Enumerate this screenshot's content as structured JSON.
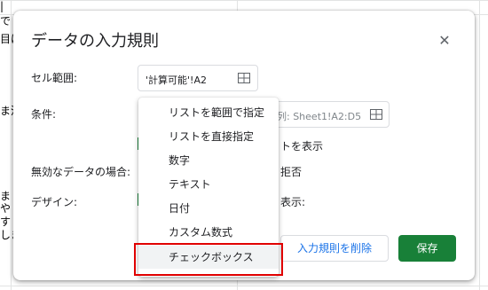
{
  "background": {
    "fragments": [
      "|",
      "で",
      "目は",
      "ま活",
      "ま",
      "や",
      "す",
      "しま"
    ]
  },
  "dialog": {
    "title": "データの入力規則",
    "close_icon": "close-icon",
    "labels": {
      "range": "セル範囲:",
      "criteria": "条件:",
      "invalid": "無効なデータの場合:",
      "design": "デザイン:"
    },
    "range_value": "'計算可能'!A2",
    "criteria_placeholder": "列: Sheet1!A2:D5",
    "partial_texts": {
      "show": "トを表示",
      "reject": "拒否",
      "display": "表示:"
    },
    "buttons": {
      "delete": "入力規則を削除",
      "save": "保存"
    }
  },
  "menu": {
    "items": [
      {
        "label": "リストを範囲で指定"
      },
      {
        "label": "リストを直接指定"
      },
      {
        "label": "数字"
      },
      {
        "label": "テキスト"
      },
      {
        "label": "日付"
      },
      {
        "label": "カスタム数式"
      },
      {
        "label": "チェックボックス"
      }
    ],
    "highlighted_index": 6
  },
  "colors": {
    "save_button": "#188038",
    "highlight_border": "#e00000",
    "delete_text": "#1a73e8"
  }
}
